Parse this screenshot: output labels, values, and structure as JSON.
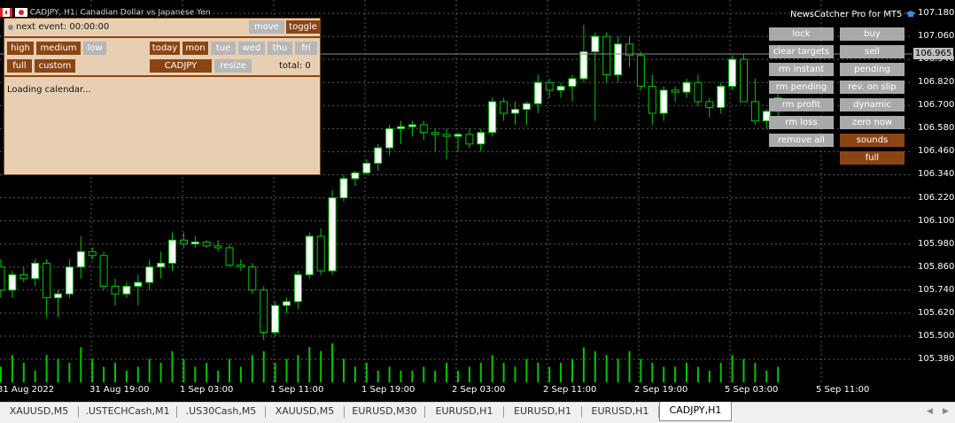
{
  "window": {
    "title": "CADJPY, H1: Canadian Dollar vs Japanese Yen"
  },
  "panel": {
    "next_event": "next event: 00:00:00",
    "move": "move",
    "toggle": "toggle",
    "impact": [
      "high",
      "medium",
      "low"
    ],
    "days": [
      "today",
      "mon",
      "tue",
      "wed",
      "thu",
      "fri"
    ],
    "full": "full",
    "custom": "custom",
    "symbol": "CADJPY",
    "resize": "resize",
    "total": "total: 0",
    "loading": "Loading calendar..."
  },
  "newscatcher": {
    "title": "NewsCatcher Pro for MT5",
    "left_buttons": [
      "lock",
      "clear targets",
      "rm instant",
      "rm pending",
      "rm profit",
      "rm loss",
      "remove all"
    ],
    "right_buttons": [
      "buy",
      "sell",
      "pending",
      "rev. on slip",
      "dynamic",
      "zero now",
      "sounds",
      "full"
    ]
  },
  "price_axis": {
    "labels": [
      "107.180",
      "107.060",
      "106.940",
      "106.820",
      "106.700",
      "106.580",
      "106.460",
      "106.340",
      "106.220",
      "106.100",
      "105.980",
      "105.860",
      "105.740",
      "105.620",
      "105.500",
      "105.380"
    ],
    "current": "106.965"
  },
  "time_axis": [
    "31 Aug 2022",
    "31 Aug 19:00",
    "1 Sep 03:00",
    "1 Sep 11:00",
    "1 Sep 19:00",
    "2 Sep 03:00",
    "2 Sep 11:00",
    "2 Sep 19:00",
    "5 Sep 03:00",
    "5 Sep 11:00"
  ],
  "tabs": [
    "XAUUSD,M5",
    ".USTECHCash,M1",
    ".US30Cash,M5",
    "XAUUSD,M5",
    "EURUSD,M30",
    "EURUSD,H1",
    "EURUSD,H1",
    "EURUSD,H1",
    "CADJPY,H1"
  ],
  "active_tab": "CADJPY,H1",
  "colors": {
    "background": "#000000",
    "candle_up": "#ffffff",
    "wick": "#00c800",
    "grid": "#5a5a5a",
    "panel_bg": "#e8cfb2",
    "panel_brown": "#8b4513",
    "panel_grey": "#a9a9a9"
  },
  "chart_data": {
    "type": "candlestick",
    "timeframe": "H1",
    "symbol": "CADJPY",
    "ylim": [
      105.32,
      107.2
    ],
    "candles": [
      [
        105.86,
        105.9,
        105.7,
        105.74
      ],
      [
        105.74,
        105.84,
        105.7,
        105.82
      ],
      [
        105.82,
        105.86,
        105.78,
        105.8
      ],
      [
        105.8,
        105.9,
        105.76,
        105.88
      ],
      [
        105.88,
        105.9,
        105.6,
        105.7
      ],
      [
        105.7,
        105.74,
        105.6,
        105.72
      ],
      [
        105.72,
        105.9,
        105.7,
        105.86
      ],
      [
        105.86,
        106.02,
        105.8,
        105.94
      ],
      [
        105.94,
        105.96,
        105.9,
        105.92
      ],
      [
        105.92,
        105.94,
        105.74,
        105.76
      ],
      [
        105.76,
        105.8,
        105.66,
        105.72
      ],
      [
        105.72,
        105.78,
        105.7,
        105.76
      ],
      [
        105.76,
        105.82,
        105.66,
        105.78
      ],
      [
        105.78,
        105.9,
        105.74,
        105.86
      ],
      [
        105.86,
        105.94,
        105.8,
        105.88
      ],
      [
        105.88,
        106.04,
        105.84,
        106.0
      ],
      [
        106.0,
        106.04,
        105.96,
        105.98
      ],
      [
        105.98,
        106.02,
        105.96,
        105.99
      ],
      [
        105.99,
        106.0,
        105.96,
        105.97
      ],
      [
        105.97,
        106.0,
        105.94,
        105.96
      ],
      [
        105.96,
        105.98,
        105.86,
        105.87
      ],
      [
        105.87,
        105.9,
        105.84,
        105.86
      ],
      [
        105.86,
        105.88,
        105.72,
        105.74
      ],
      [
        105.74,
        105.76,
        105.48,
        105.52
      ],
      [
        105.52,
        105.68,
        105.5,
        105.66
      ],
      [
        105.66,
        105.7,
        105.62,
        105.68
      ],
      [
        105.68,
        105.84,
        105.64,
        105.82
      ],
      [
        105.82,
        106.04,
        105.8,
        106.02
      ],
      [
        106.02,
        106.06,
        105.82,
        105.84
      ],
      [
        105.84,
        106.26,
        105.82,
        106.22
      ],
      [
        106.22,
        106.34,
        106.2,
        106.32
      ],
      [
        106.32,
        106.36,
        106.28,
        106.35
      ],
      [
        106.35,
        106.42,
        106.34,
        106.4
      ],
      [
        106.4,
        106.5,
        106.36,
        106.48
      ],
      [
        106.48,
        106.6,
        106.44,
        106.58
      ],
      [
        106.58,
        106.62,
        106.5,
        106.59
      ],
      [
        106.59,
        106.62,
        106.54,
        106.6
      ],
      [
        106.6,
        106.62,
        106.52,
        106.56
      ],
      [
        106.56,
        106.58,
        106.46,
        106.55
      ],
      [
        106.55,
        106.58,
        106.42,
        106.54
      ],
      [
        106.54,
        106.56,
        106.46,
        106.55
      ],
      [
        106.55,
        106.58,
        106.48,
        106.5
      ],
      [
        106.5,
        106.58,
        106.46,
        106.56
      ],
      [
        106.56,
        106.74,
        106.54,
        106.72
      ],
      [
        106.72,
        106.74,
        106.62,
        106.66
      ],
      [
        106.66,
        106.72,
        106.6,
        106.68
      ],
      [
        106.68,
        106.72,
        106.6,
        106.71
      ],
      [
        106.71,
        106.86,
        106.66,
        106.82
      ],
      [
        106.82,
        106.84,
        106.74,
        106.78
      ],
      [
        106.78,
        106.82,
        106.74,
        106.8
      ],
      [
        106.8,
        106.86,
        106.72,
        106.84
      ],
      [
        106.84,
        107.12,
        106.82,
        106.98
      ],
      [
        106.98,
        107.08,
        106.62,
        107.06
      ],
      [
        107.06,
        107.08,
        106.82,
        106.86
      ],
      [
        106.86,
        107.06,
        106.82,
        107.02
      ],
      [
        107.02,
        107.06,
        106.9,
        106.96
      ],
      [
        106.96,
        106.98,
        106.78,
        106.8
      ],
      [
        106.8,
        106.86,
        106.6,
        106.66
      ],
      [
        106.66,
        106.8,
        106.62,
        106.78
      ],
      [
        106.78,
        106.8,
        106.72,
        106.77
      ],
      [
        106.77,
        106.84,
        106.74,
        106.82
      ],
      [
        106.82,
        106.86,
        106.7,
        106.72
      ],
      [
        106.72,
        106.74,
        106.64,
        106.69
      ],
      [
        106.69,
        106.82,
        106.66,
        106.8
      ],
      [
        106.8,
        106.96,
        106.78,
        106.94
      ],
      [
        106.94,
        106.97,
        106.76,
        106.72
      ],
      [
        106.72,
        106.84,
        106.6,
        106.62
      ],
      [
        106.62,
        106.68,
        106.58,
        106.67
      ],
      [
        106.67,
        106.76,
        106.64,
        106.74
      ]
    ],
    "volume_levels": [
      0.4,
      0.7,
      0.5,
      0.3,
      0.7,
      0.6,
      0.5,
      0.9,
      0.6,
      0.4,
      0.5,
      0.3,
      0.4,
      0.6,
      0.5,
      0.8,
      0.6,
      0.4,
      0.5,
      0.3,
      0.6,
      0.4,
      0.7,
      0.8,
      0.5,
      0.6,
      0.7,
      0.9,
      0.8,
      1.0,
      0.6,
      0.4,
      0.5,
      0.3,
      0.4,
      0.3,
      0.3,
      0.4,
      0.3,
      0.5,
      0.3,
      0.4,
      0.5,
      0.7,
      0.5,
      0.4,
      0.6,
      0.5,
      0.4,
      0.5,
      0.6,
      0.9,
      0.8,
      0.7,
      0.6,
      0.8,
      0.6,
      0.5,
      0.4,
      0.4,
      0.5,
      0.4,
      0.3,
      0.5,
      0.7,
      0.6,
      0.5,
      0.3,
      0.4
    ]
  }
}
